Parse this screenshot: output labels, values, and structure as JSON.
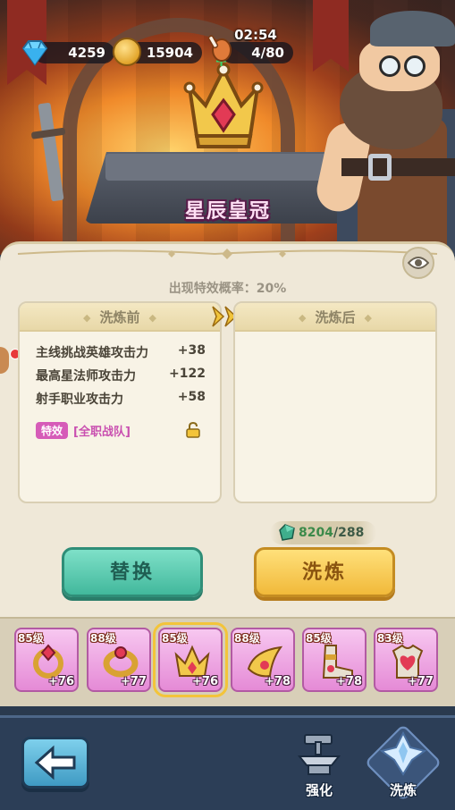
{
  "resources": {
    "gems": "4259",
    "coins": "15904",
    "energy": "4/80",
    "timer": "02:54"
  },
  "item": {
    "name": "星辰皇冠",
    "probability_label": "出现特效概率：20%"
  },
  "before": {
    "title": "洗炼前",
    "stats": [
      {
        "name": "主线挑战英雄攻击力",
        "value": "+38"
      },
      {
        "name": "最高星法师攻击力",
        "value": "+122"
      },
      {
        "name": "射手职业攻击力",
        "value": "+58"
      }
    ],
    "special_tag": "特效",
    "special_text": "[全职战队]"
  },
  "after": {
    "title": "洗炼后"
  },
  "cost": {
    "current": "8204",
    "required": "/288"
  },
  "buttons": {
    "replace": "替换",
    "refine": "洗炼"
  },
  "equipment": [
    {
      "level": "85级",
      "bonus": "+76",
      "icon": "ring-icon"
    },
    {
      "level": "88级",
      "bonus": "+77",
      "icon": "bracelet-icon"
    },
    {
      "level": "85级",
      "bonus": "+76",
      "icon": "crown-icon",
      "selected": true
    },
    {
      "level": "88级",
      "bonus": "+78",
      "icon": "horn-icon"
    },
    {
      "level": "85级",
      "bonus": "+78",
      "icon": "boots-icon"
    },
    {
      "level": "83级",
      "bonus": "+77",
      "icon": "armor-icon"
    }
  ],
  "nav": {
    "strengthen": "强化",
    "refine": "洗炼"
  },
  "colors": {
    "panel_bg": "#efe8d8",
    "replace_button": "#42b89c",
    "refine_button": "#f1b93a",
    "special_tag": "#d65bb8",
    "bottom_bar": "#2c3e57"
  }
}
